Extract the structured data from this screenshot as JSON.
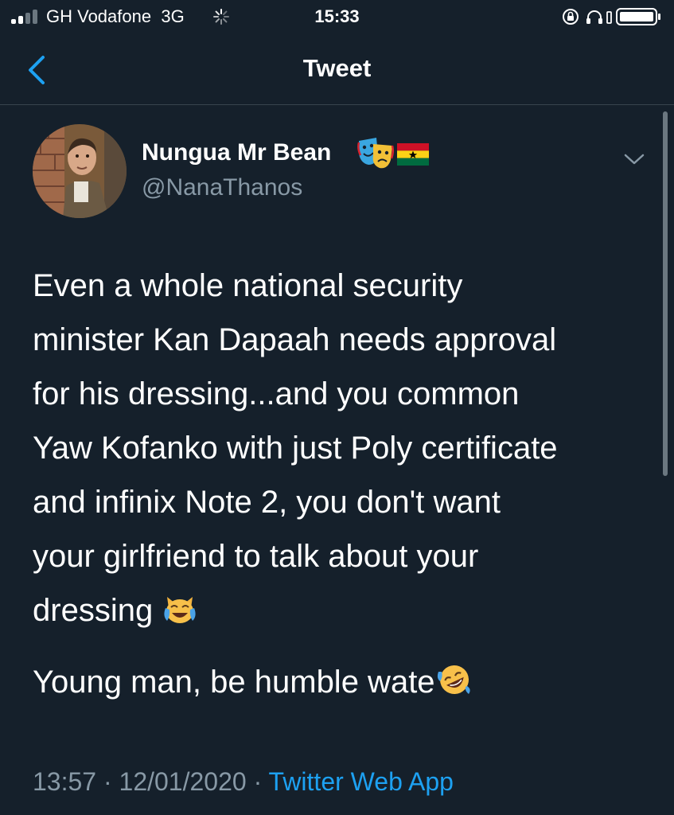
{
  "status_bar": {
    "carrier": "GH Vodafone",
    "network": "3G",
    "time": "15:33"
  },
  "nav": {
    "title": "Tweet",
    "back_icon": "chevron-left-icon"
  },
  "tweet": {
    "author": {
      "display_name": "Nungua Mr Bean",
      "handle": "@NanaThanos",
      "name_emojis": [
        "performing-arts-emoji",
        "ghana-flag-emoji"
      ]
    },
    "body": {
      "lines": [
        "Even a whole national security",
        "minister Kan Dapaah needs approval",
        "for his dressing...and you common",
        "Yaw Kofanko with just Poly certificate",
        "and infinix Note 2, you don't want",
        "your girlfriend to talk about your",
        "dressing"
      ],
      "emoji_1": "cat-tears-of-joy-emoji",
      "paragraph_2": "Young man, be humble wate",
      "emoji_2": "rolling-on-floor-laughing-emoji"
    },
    "meta": {
      "time": "13:57",
      "separator": "·",
      "date": "12/01/2020",
      "source": "Twitter Web App"
    }
  },
  "colors": {
    "background": "#15202b",
    "text": "#ffffff",
    "secondary_text": "#8899a6",
    "accent": "#1da1f2",
    "divider": "#38444d"
  }
}
